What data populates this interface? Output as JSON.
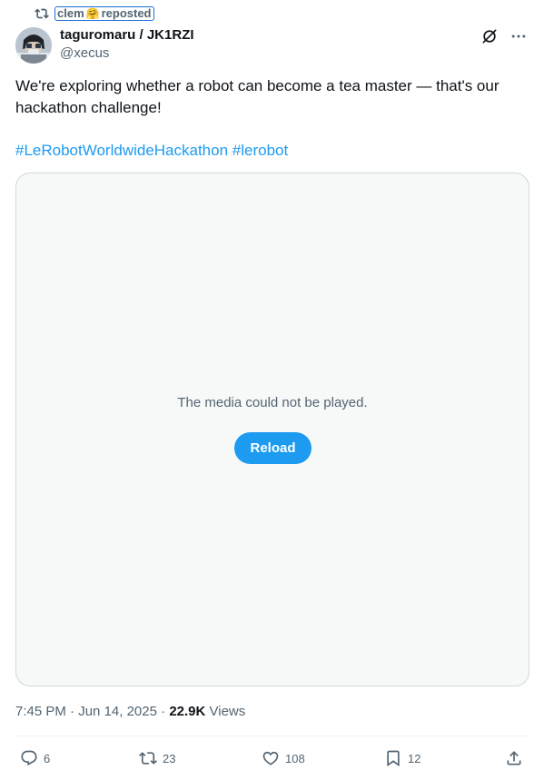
{
  "repost": {
    "user": "clem",
    "emoji": "🤗",
    "label": "reposted"
  },
  "author": {
    "display_name": "taguromaru / JK1RZI",
    "handle": "@xecus"
  },
  "tweet": {
    "text": "We're exploring whether a robot can become a tea master — that's our hackathon challenge!",
    "hashtags": [
      "#LeRobotWorldwideHackathon",
      "#lerobot"
    ]
  },
  "media": {
    "error_message": "The media could not be played.",
    "reload_label": "Reload"
  },
  "meta": {
    "time": "7:45 PM",
    "separator": "·",
    "date": "Jun 14, 2025",
    "views_count": "22.9K",
    "views_label": "Views"
  },
  "actions": {
    "replies": "6",
    "reposts": "23",
    "likes": "108",
    "bookmarks": "12"
  },
  "icons": {
    "repost": "repost-icon",
    "grok": "grok-icon",
    "more": "more-icon",
    "reply": "reply-icon",
    "like": "heart-icon",
    "bookmark": "bookmark-icon",
    "share": "share-icon"
  },
  "colors": {
    "accent": "#1d9bf0",
    "secondary_text": "#536471",
    "primary_text": "#0f1419"
  }
}
